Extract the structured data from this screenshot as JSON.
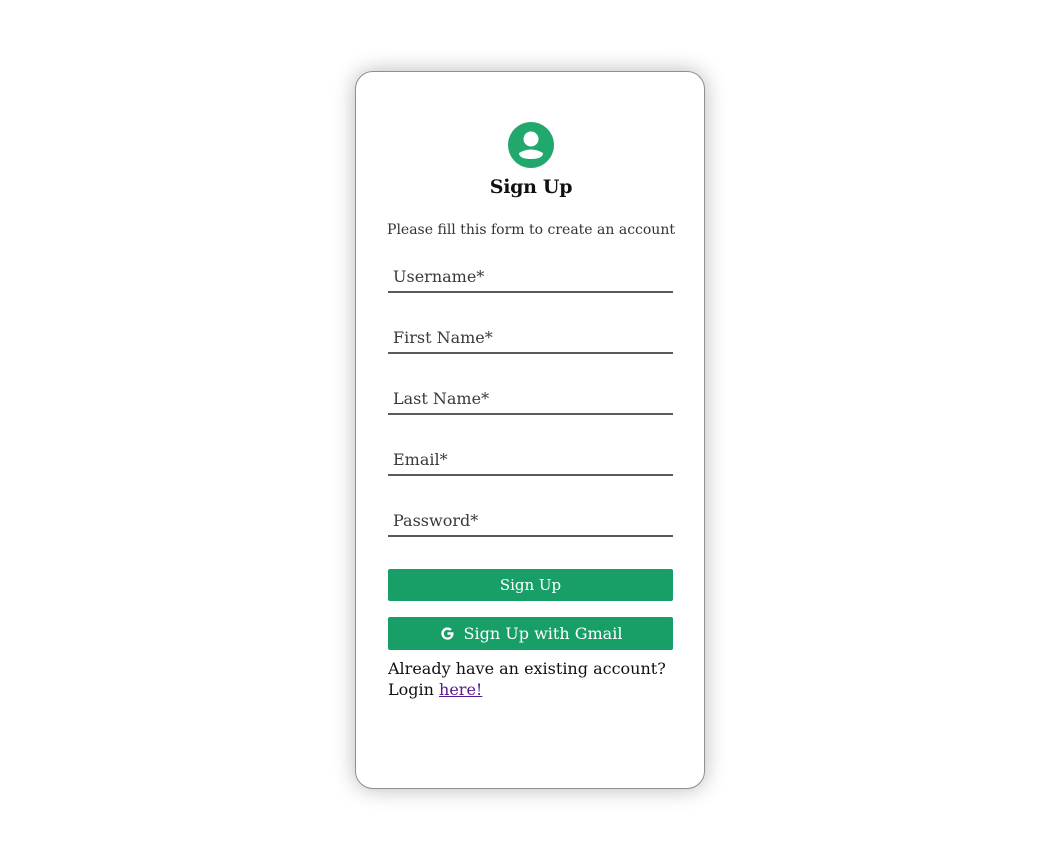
{
  "form": {
    "title": "Sign Up",
    "subtitle": "Please fill this form to create an account",
    "username_placeholder": "Username*",
    "first_name_placeholder": "First Name*",
    "last_name_placeholder": "Last Name*",
    "email_placeholder": "Email*",
    "password_placeholder": "Password*",
    "signup_label": "Sign Up",
    "gmail_label": "Sign Up with Gmail",
    "existing_account_text": "Already have an existing account?",
    "login_prefix": "Login",
    "login_link_text": "here!"
  },
  "icons": {
    "avatar": "user-circle-icon",
    "gmail": "google-icon"
  },
  "colors": {
    "accent": "#189f67",
    "avatar": "#21a86d",
    "link": "#551a8b"
  }
}
